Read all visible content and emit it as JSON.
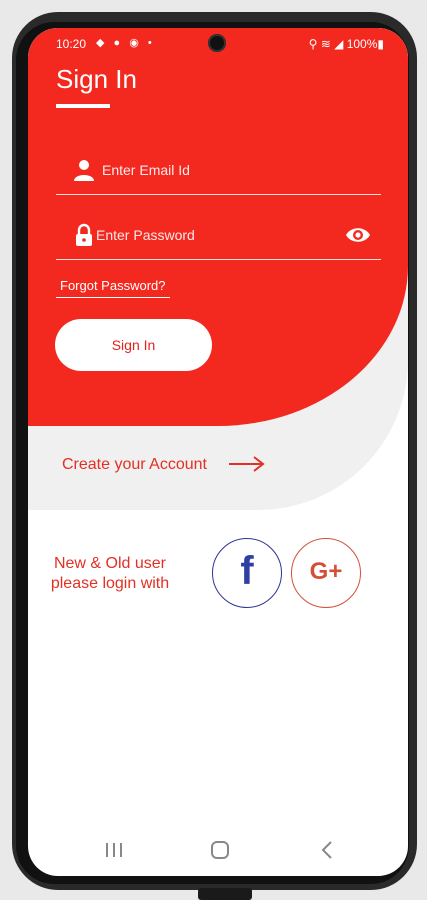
{
  "status_bar": {
    "time": "10:20",
    "notification_icons": "◆ ● ◉ •",
    "right_status": "⚲ ≋ ◢ 100%▮"
  },
  "header": {
    "title": "Sign In"
  },
  "form": {
    "email_placeholder": "Enter Email Id",
    "password_placeholder": "Enter Password",
    "forgot_label": "Forgot Password?",
    "signin_label": "Sign In"
  },
  "create_account": {
    "label": "Create your Account"
  },
  "social": {
    "line1": "New & Old user",
    "line2": "please login with",
    "facebook_label": "f",
    "google_label": "G+"
  },
  "colors": {
    "primary_red": "#f3281f",
    "text_red": "#e33024",
    "facebook_blue": "#2f3fa4",
    "google_red": "#d2503a"
  },
  "icons": {
    "email": "user-icon",
    "password": "lock-icon",
    "show_password": "eye-icon",
    "create_account": "arrow-right-icon",
    "nav": [
      "recents-icon",
      "home-icon",
      "back-icon"
    ]
  }
}
